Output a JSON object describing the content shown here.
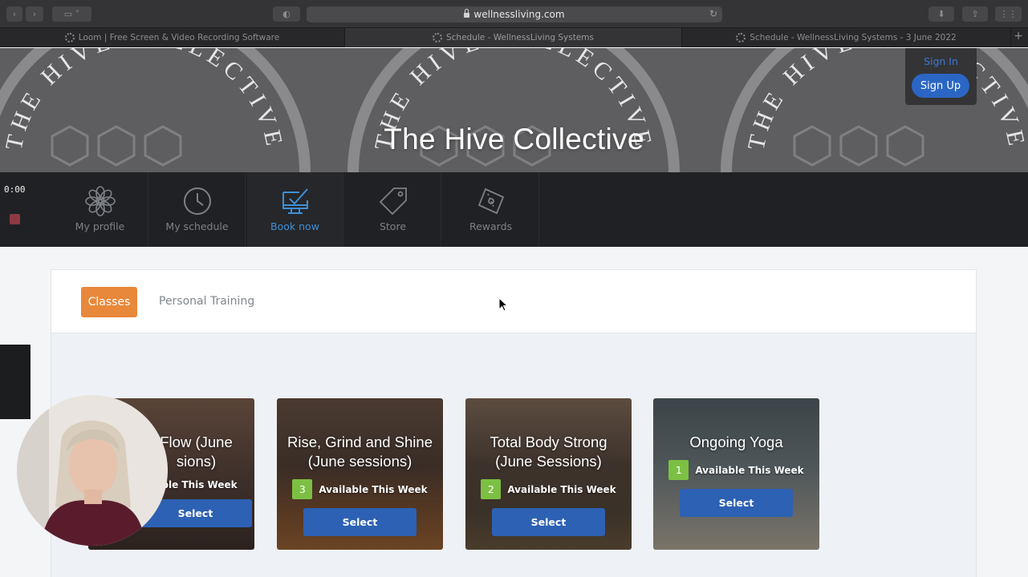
{
  "browser": {
    "url": "wellnessliving.com",
    "tabs": [
      {
        "title": "Loom | Free Screen & Video Recording Software",
        "active": false
      },
      {
        "title": "Schedule - WellnessLiving Systems",
        "active": true
      },
      {
        "title": "Schedule - WellnessLiving Systems - 3 June 2022",
        "active": false
      }
    ],
    "new_tab": "+"
  },
  "banner": {
    "logo_text": "THE HIVE COLLECTIVE",
    "title": "The Hive Collective"
  },
  "auth": {
    "sign_in": "Sign In",
    "sign_up": "Sign Up"
  },
  "recorder": {
    "time": "0:00"
  },
  "nav": {
    "items": [
      {
        "label": "My profile",
        "icon": "flower-icon"
      },
      {
        "label": "My schedule",
        "icon": "clock-icon"
      },
      {
        "label": "Book now",
        "icon": "monitor-check-icon",
        "active": true
      },
      {
        "label": "Store",
        "icon": "tag-icon"
      },
      {
        "label": "Rewards",
        "icon": "coupon-icon"
      }
    ]
  },
  "booking": {
    "tabs": [
      {
        "label": "Classes",
        "active": true
      },
      {
        "label": "Personal Training",
        "active": false
      }
    ],
    "cards": [
      {
        "title": "Flow (June sions)",
        "count": "",
        "availability": "ble This Week",
        "button": "Select"
      },
      {
        "title": "Rise, Grind and Shine (June sessions)",
        "count": "3",
        "availability": "Available This Week",
        "button": "Select"
      },
      {
        "title": "Total Body Strong (June Sessions)",
        "count": "2",
        "availability": "Available This Week",
        "button": "Select"
      },
      {
        "title": "Ongoing Yoga",
        "count": "1",
        "availability": "Available This Week",
        "button": "Select"
      }
    ]
  },
  "colors": {
    "accent_orange": "#e8883a",
    "button_blue": "#2d61b3",
    "count_green": "#7cc043",
    "nav_active": "#3f8fd6"
  }
}
